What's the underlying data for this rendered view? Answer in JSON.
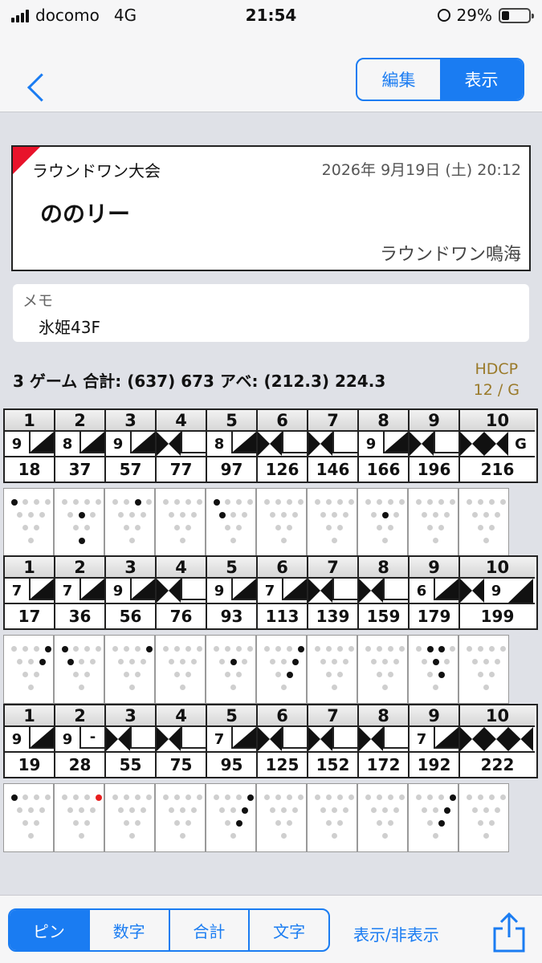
{
  "status": {
    "carrier": "docomo",
    "network": "4G",
    "time": "21:54",
    "battery": "29%"
  },
  "nav": {
    "seg_edit": "編集",
    "seg_view": "表示"
  },
  "info": {
    "event": "ラウンドワン大会",
    "date": "2026年  9月19日 (土)  20:12",
    "player": "ののリー",
    "center": "ラウンドワン鳴海"
  },
  "memo": {
    "label": "メモ",
    "value": "氷姫43F"
  },
  "summary": {
    "text": "3 ゲーム  合計: (637) 673   アベ: (212.3) 224.3",
    "hdcp_label": "HDCP",
    "hdcp_value": "12 / G"
  },
  "games": [
    {
      "frames": [
        {
          "num": "1",
          "balls": [
            "9",
            "/"
          ],
          "score": "18",
          "pins": [
            7
          ]
        },
        {
          "num": "2",
          "balls": [
            "8",
            "/"
          ],
          "score": "37",
          "pins": [
            5,
            1
          ]
        },
        {
          "num": "3",
          "balls": [
            "9",
            "/"
          ],
          "score": "57",
          "pins": [
            9
          ]
        },
        {
          "num": "4",
          "balls": [
            "X",
            ""
          ],
          "score": "77",
          "pins": []
        },
        {
          "num": "5",
          "balls": [
            "8",
            "/"
          ],
          "score": "97",
          "pins": [
            7,
            4
          ]
        },
        {
          "num": "6",
          "balls": [
            "X",
            ""
          ],
          "score": "126",
          "pins": []
        },
        {
          "num": "7",
          "balls": [
            "X",
            ""
          ],
          "score": "146",
          "pins": []
        },
        {
          "num": "8",
          "balls": [
            "9",
            "/"
          ],
          "score": "166",
          "pins": [
            5
          ]
        },
        {
          "num": "9",
          "balls": [
            "X",
            ""
          ],
          "score": "196",
          "pins": []
        },
        {
          "num": "10",
          "balls": [
            "X",
            "X",
            "G"
          ],
          "score": "216",
          "pins": []
        }
      ]
    },
    {
      "frames": [
        {
          "num": "1",
          "balls": [
            "7",
            "/"
          ],
          "score": "17",
          "pins": [
            10,
            6
          ]
        },
        {
          "num": "2",
          "balls": [
            "7",
            "/"
          ],
          "score": "36",
          "pins": [
            7,
            4
          ]
        },
        {
          "num": "3",
          "balls": [
            "9",
            "/"
          ],
          "score": "56",
          "pins": [
            10
          ]
        },
        {
          "num": "4",
          "balls": [
            "X",
            ""
          ],
          "score": "76",
          "pins": []
        },
        {
          "num": "5",
          "balls": [
            "9",
            "/"
          ],
          "score": "93",
          "pins": [
            5
          ]
        },
        {
          "num": "6",
          "balls": [
            "7",
            "/"
          ],
          "score": "113",
          "pins": [
            10,
            6,
            3
          ]
        },
        {
          "num": "7",
          "balls": [
            "X",
            ""
          ],
          "score": "139",
          "pins": []
        },
        {
          "num": "8",
          "balls": [
            "X",
            ""
          ],
          "score": "159",
          "pins": []
        },
        {
          "num": "9",
          "balls": [
            "6",
            "/"
          ],
          "score": "179",
          "pins": [
            8,
            5,
            3,
            9
          ]
        },
        {
          "num": "10",
          "balls": [
            "X",
            "9",
            "/"
          ],
          "score": "199",
          "pins": []
        }
      ]
    },
    {
      "frames": [
        {
          "num": "1",
          "balls": [
            "9",
            "/"
          ],
          "score": "19",
          "pins": [
            7
          ]
        },
        {
          "num": "2",
          "balls": [
            "9",
            "-"
          ],
          "score": "28",
          "pins": [],
          "red": [
            10
          ]
        },
        {
          "num": "3",
          "balls": [
            "X",
            ""
          ],
          "score": "55",
          "pins": []
        },
        {
          "num": "4",
          "balls": [
            "X",
            ""
          ],
          "score": "75",
          "pins": []
        },
        {
          "num": "5",
          "balls": [
            "7",
            "/"
          ],
          "score": "95",
          "pins": [
            10,
            6,
            3
          ]
        },
        {
          "num": "6",
          "balls": [
            "X",
            ""
          ],
          "score": "125",
          "pins": []
        },
        {
          "num": "7",
          "balls": [
            "X",
            ""
          ],
          "score": "152",
          "pins": []
        },
        {
          "num": "8",
          "balls": [
            "X",
            ""
          ],
          "score": "172",
          "pins": []
        },
        {
          "num": "9",
          "balls": [
            "7",
            "/"
          ],
          "score": "192",
          "pins": [
            10,
            6,
            3
          ]
        },
        {
          "num": "10",
          "balls": [
            "X",
            "X",
            "X"
          ],
          "score": "222",
          "pins": []
        }
      ]
    }
  ],
  "tabbar": {
    "tabs": [
      "ピン",
      "数字",
      "合計",
      "文字"
    ],
    "toggle": "表示/非表示"
  },
  "colors": {
    "accent": "#1a7cf2",
    "corner": "#e8132b",
    "hdcp": "#9a7a2a"
  }
}
